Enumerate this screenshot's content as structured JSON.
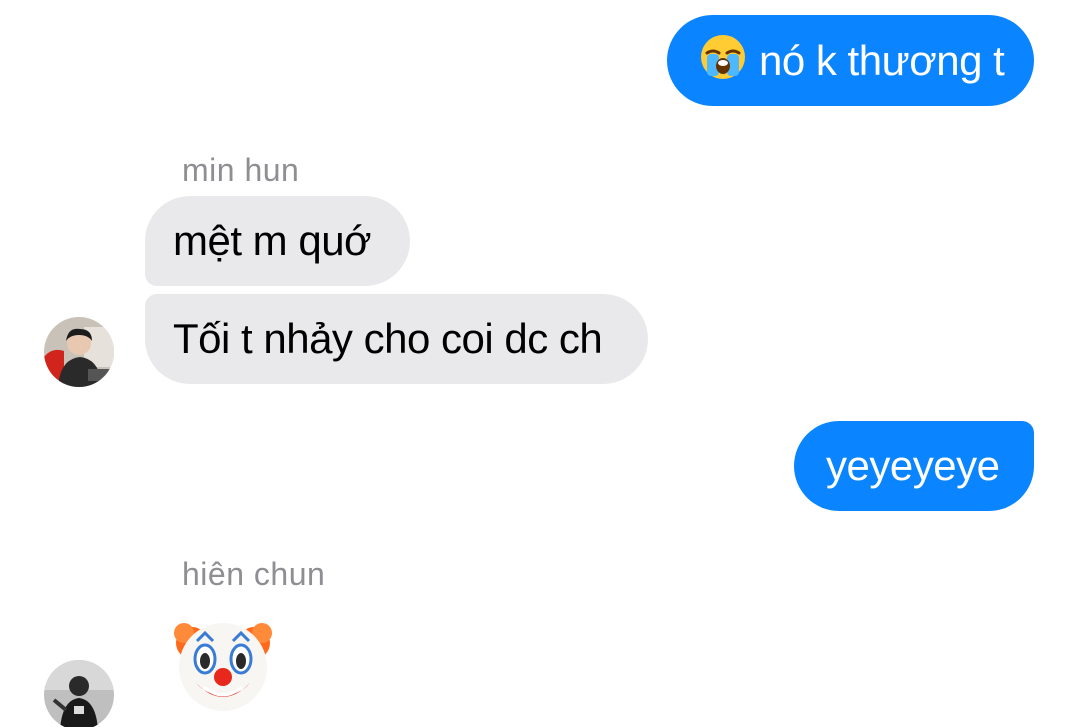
{
  "colors": {
    "outgoing_bubble": "#0a84ff",
    "incoming_bubble": "#e9e9eb",
    "sender_name": "#8e8e93"
  },
  "messages": [
    {
      "direction": "outgoing",
      "emoji": "loudly-crying-face-emoji",
      "text": "nó k thương t"
    },
    {
      "direction": "incoming",
      "sender": "min hun",
      "text": "mệt m quớ"
    },
    {
      "direction": "incoming",
      "sender": "min hun",
      "text": "Tối t nhảy cho coi dc ch"
    },
    {
      "direction": "outgoing",
      "text": "yeyeyeye"
    },
    {
      "direction": "incoming",
      "sender": "hiên chun",
      "emoji": "clown-face-emoji"
    }
  ]
}
